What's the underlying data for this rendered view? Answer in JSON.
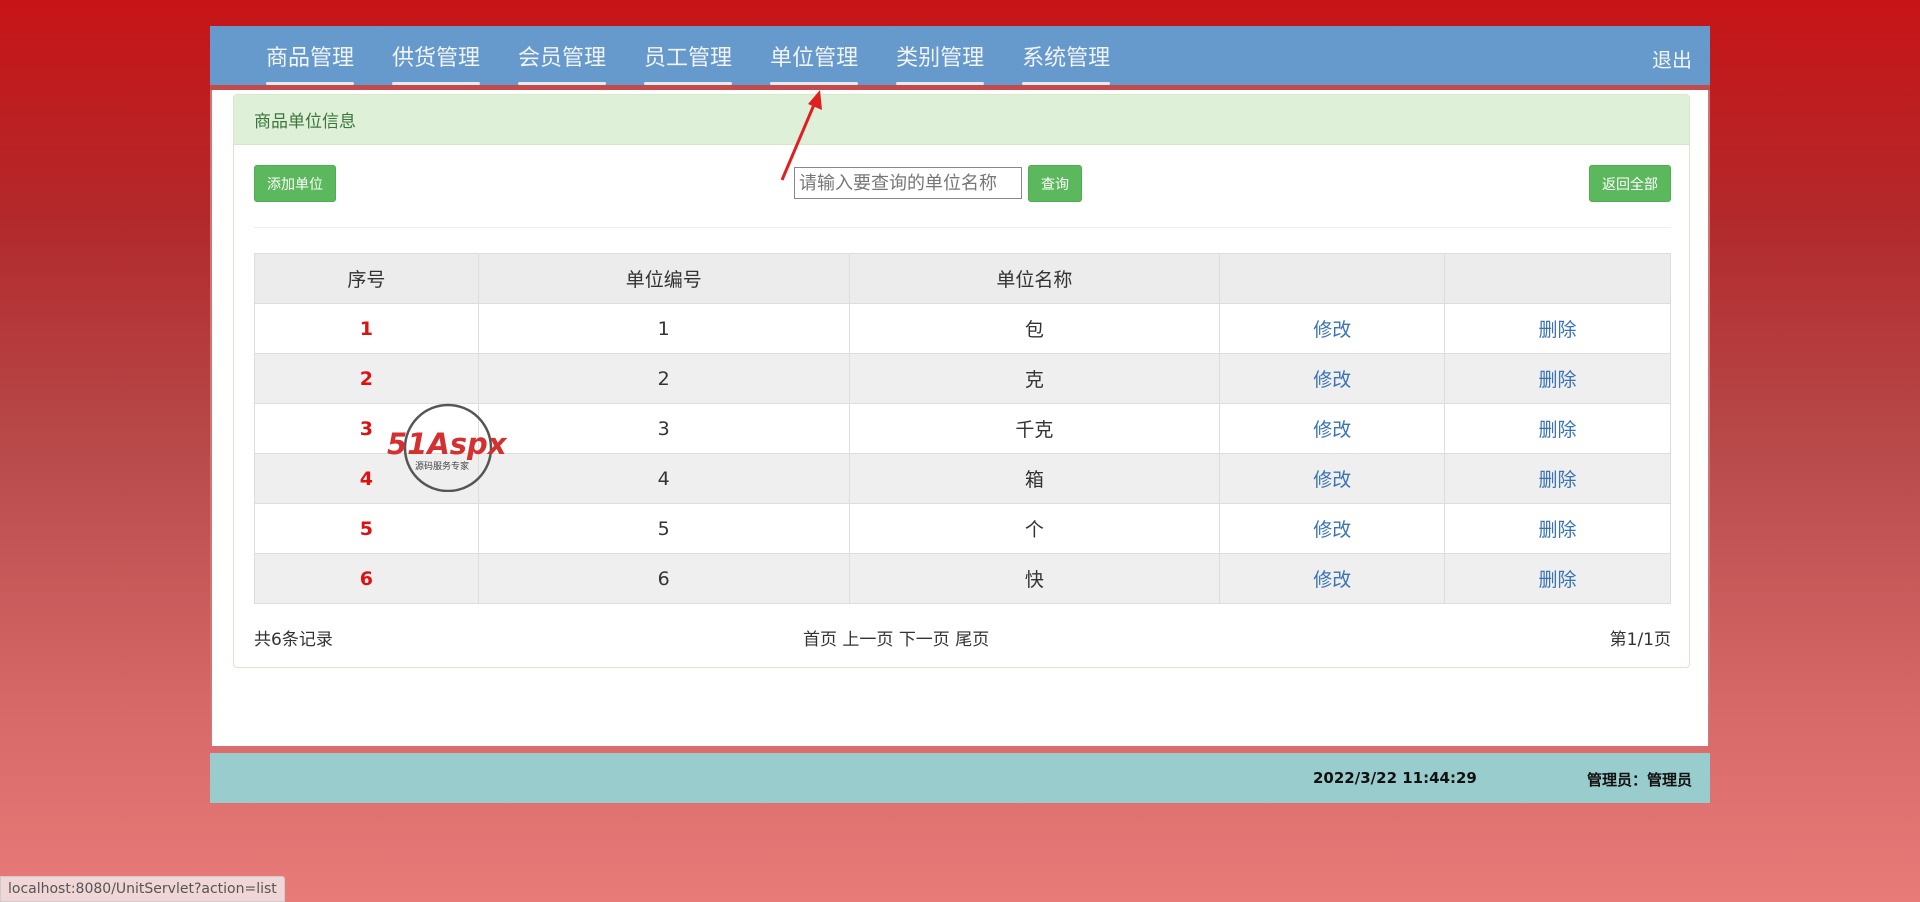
{
  "nav": {
    "items": [
      "商品管理",
      "供货管理",
      "会员管理",
      "员工管理",
      "单位管理",
      "类别管理",
      "系统管理"
    ],
    "logout": "退出"
  },
  "panel": {
    "title": "商品单位信息",
    "add_label": "添加单位",
    "search_placeholder": "请输入要查询的单位名称",
    "search_label": "查询",
    "reset_label": "返回全部"
  },
  "table": {
    "headers": [
      "序号",
      "单位编号",
      "单位名称",
      "",
      ""
    ],
    "rows": [
      {
        "idx": "1",
        "code": "1",
        "name": "包",
        "edit": "修改",
        "del": "删除"
      },
      {
        "idx": "2",
        "code": "2",
        "name": "克",
        "edit": "修改",
        "del": "删除"
      },
      {
        "idx": "3",
        "code": "3",
        "name": "千克",
        "edit": "修改",
        "del": "删除"
      },
      {
        "idx": "4",
        "code": "4",
        "name": "箱",
        "edit": "修改",
        "del": "删除"
      },
      {
        "idx": "5",
        "code": "5",
        "name": "个",
        "edit": "修改",
        "del": "删除"
      },
      {
        "idx": "6",
        "code": "6",
        "name": "快",
        "edit": "修改",
        "del": "删除"
      }
    ]
  },
  "pager": {
    "total": "共6条记录",
    "first": "首页",
    "prev": "上一页",
    "next": "下一页",
    "last": "尾页",
    "page": "第1/1页"
  },
  "status": {
    "datetime": "2022/3/22 11:44:29",
    "admin": "管理员：管理员"
  },
  "watermark": {
    "logo": "51Aspx",
    "tagline": "源码服务专家"
  },
  "url_tip": "localhost:8080/UnitServlet?action=list",
  "colors": {
    "nav_bg": "#6699cc",
    "button_green": "#5cb85c",
    "panel_heading": "#dff0d8",
    "status_bg": "#99cccc",
    "index_red": "#dd1111",
    "link_blue": "#3872b8"
  }
}
